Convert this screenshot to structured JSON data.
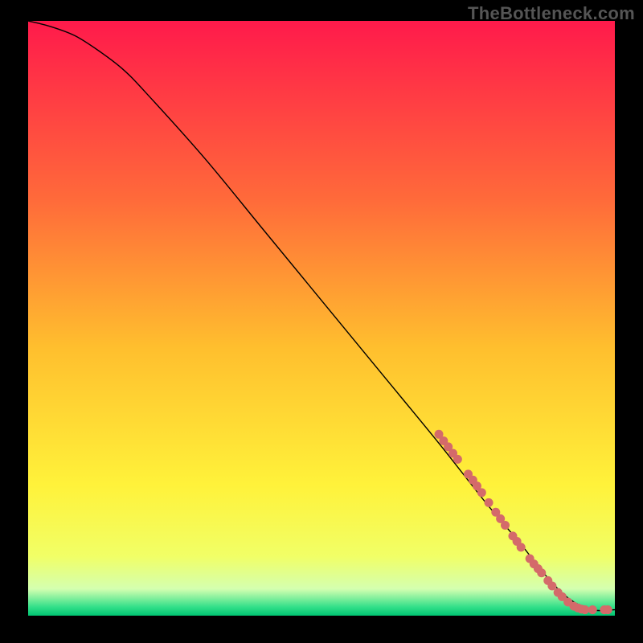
{
  "watermark": "TheBottleneck.com",
  "chart_data": {
    "type": "line",
    "title": "",
    "xlabel": "",
    "ylabel": "",
    "xlim": [
      0,
      100
    ],
    "ylim": [
      0,
      100
    ],
    "grid": false,
    "legend": false,
    "background_gradient": {
      "stops": [
        {
          "offset": 0.0,
          "color": "#ff1a4b"
        },
        {
          "offset": 0.3,
          "color": "#ff6a3a"
        },
        {
          "offset": 0.55,
          "color": "#ffbf2e"
        },
        {
          "offset": 0.78,
          "color": "#fff23a"
        },
        {
          "offset": 0.9,
          "color": "#f1ff66"
        },
        {
          "offset": 0.955,
          "color": "#d4ffb0"
        },
        {
          "offset": 0.985,
          "color": "#35e08a"
        },
        {
          "offset": 1.0,
          "color": "#00c472"
        }
      ]
    },
    "series": [
      {
        "name": "curve",
        "color": "#000000",
        "stroke_width": 1.4,
        "x": [
          0,
          4,
          8,
          12,
          16,
          20,
          30,
          40,
          50,
          60,
          70,
          78,
          84,
          88,
          92,
          96,
          100
        ],
        "y": [
          100,
          99,
          97.5,
          95,
          92,
          88,
          77,
          65,
          53,
          41,
          29,
          19,
          12,
          7,
          3,
          1,
          1
        ]
      }
    ],
    "markers": {
      "name": "dots",
      "color": "#d46a6a",
      "radius": 5.5,
      "points": [
        {
          "x": 70.0,
          "y": 30.5
        },
        {
          "x": 70.8,
          "y": 29.4
        },
        {
          "x": 71.6,
          "y": 28.4
        },
        {
          "x": 72.4,
          "y": 27.3
        },
        {
          "x": 73.2,
          "y": 26.3
        },
        {
          "x": 75.0,
          "y": 23.8
        },
        {
          "x": 75.8,
          "y": 22.8
        },
        {
          "x": 76.5,
          "y": 21.8
        },
        {
          "x": 77.3,
          "y": 20.7
        },
        {
          "x": 78.5,
          "y": 19.0
        },
        {
          "x": 79.7,
          "y": 17.4
        },
        {
          "x": 80.5,
          "y": 16.3
        },
        {
          "x": 81.3,
          "y": 15.2
        },
        {
          "x": 82.6,
          "y": 13.4
        },
        {
          "x": 83.3,
          "y": 12.5
        },
        {
          "x": 84.0,
          "y": 11.5
        },
        {
          "x": 85.5,
          "y": 9.6
        },
        {
          "x": 86.2,
          "y": 8.7
        },
        {
          "x": 86.9,
          "y": 7.9
        },
        {
          "x": 87.5,
          "y": 7.2
        },
        {
          "x": 88.6,
          "y": 5.9
        },
        {
          "x": 89.3,
          "y": 5.0
        },
        {
          "x": 90.3,
          "y": 3.9
        },
        {
          "x": 91.0,
          "y": 3.2
        },
        {
          "x": 92.0,
          "y": 2.3
        },
        {
          "x": 93.0,
          "y": 1.6
        },
        {
          "x": 93.7,
          "y": 1.3
        },
        {
          "x": 94.3,
          "y": 1.1
        },
        {
          "x": 94.9,
          "y": 1.0
        },
        {
          "x": 96.2,
          "y": 1.0
        },
        {
          "x": 98.2,
          "y": 1.0
        },
        {
          "x": 98.8,
          "y": 1.0
        }
      ]
    }
  }
}
